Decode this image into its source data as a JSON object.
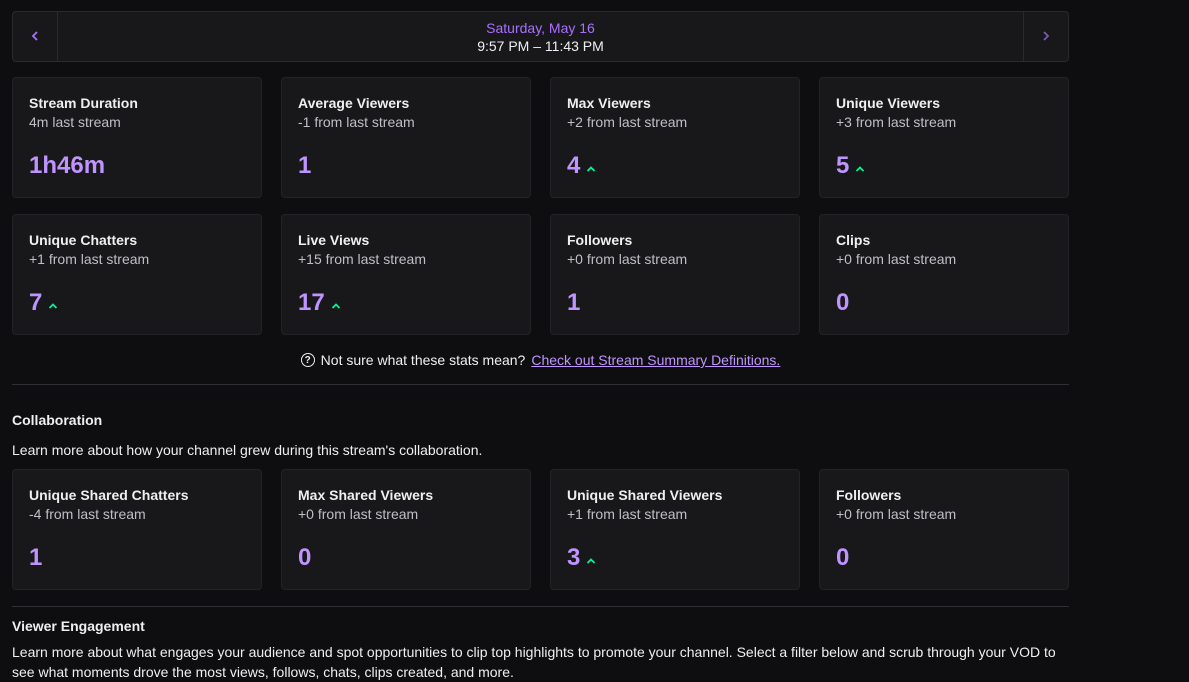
{
  "datebar": {
    "prev_icon": "chevron-left-icon",
    "next_icon": "chevron-right-icon",
    "day": "Saturday, May 16",
    "time": "9:57 PM – 11:43 PM"
  },
  "stats_row1": [
    {
      "title": "Stream Duration",
      "sub": "4m last stream",
      "value": "1h46m",
      "trend_up": false
    },
    {
      "title": "Average Viewers",
      "sub": "-1 from last stream",
      "value": "1",
      "trend_up": false
    },
    {
      "title": "Max Viewers",
      "sub": "+2 from last stream",
      "value": "4",
      "trend_up": true
    },
    {
      "title": "Unique Viewers",
      "sub": "+3 from last stream",
      "value": "5",
      "trend_up": true
    }
  ],
  "stats_row2": [
    {
      "title": "Unique Chatters",
      "sub": "+1 from last stream",
      "value": "7",
      "trend_up": true
    },
    {
      "title": "Live Views",
      "sub": "+15 from last stream",
      "value": "17",
      "trend_up": true
    },
    {
      "title": "Followers",
      "sub": "+0 from last stream",
      "value": "1",
      "trend_up": false
    },
    {
      "title": "Clips",
      "sub": "+0 from last stream",
      "value": "0",
      "trend_up": false
    }
  ],
  "help": {
    "text": "Not sure what these stats mean?",
    "link": "Check out Stream Summary Definitions."
  },
  "collaboration": {
    "title": "Collaboration",
    "desc": "Learn more about how your channel grew during this stream's collaboration.",
    "stats": [
      {
        "title": "Unique Shared Chatters",
        "sub": "-4 from last stream",
        "value": "1",
        "trend_up": false
      },
      {
        "title": "Max Shared Viewers",
        "sub": "+0 from last stream",
        "value": "0",
        "trend_up": false
      },
      {
        "title": "Unique Shared Viewers",
        "sub": "+1 from last stream",
        "value": "3",
        "trend_up": true
      },
      {
        "title": "Followers",
        "sub": "+0 from last stream",
        "value": "0",
        "trend_up": false
      }
    ]
  },
  "engagement": {
    "title": "Viewer Engagement",
    "desc": "Learn more about what engages your audience and spot opportunities to clip top highlights to promote your channel. Select a filter below and scrub through your VOD to see what moments drove the most views, follows, chats, clips created, and more."
  },
  "colors": {
    "accent": "#bf94ff",
    "trend_up": "#00f593",
    "card_bg": "#18181b",
    "page_bg": "#0e0e10"
  }
}
